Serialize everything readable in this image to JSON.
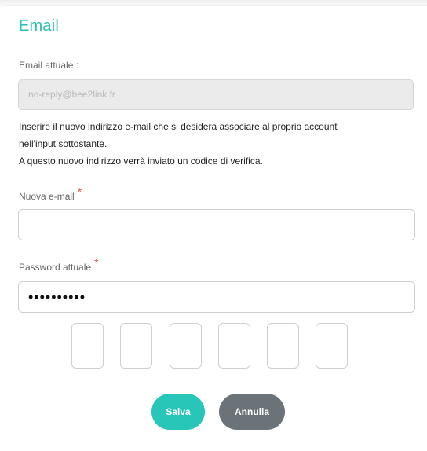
{
  "title": "Email",
  "current_email": {
    "label": "Email attuale :",
    "value": "no-reply@bee2link.fr"
  },
  "info": {
    "line1": "Inserire il nuovo indirizzo e-mail che si desidera associare al proprio account",
    "line2": "nell'input sottostante.",
    "line3": "A questo nuovo indirizzo verrà inviato un codice di verifica."
  },
  "new_email": {
    "label": "Nuova e-mail",
    "required_mark": "*",
    "value": ""
  },
  "current_password": {
    "label": "Password attuale",
    "required_mark": "*",
    "value": "••••••••••"
  },
  "verification_code": {
    "digits": [
      "",
      "",
      "",
      "",
      "",
      ""
    ]
  },
  "buttons": {
    "save": "Salva",
    "cancel": "Annulla"
  },
  "colors": {
    "accent": "#2bbdb4",
    "save_button": "#27c6b9",
    "cancel_button": "#6b7378",
    "required": "#d9534f"
  }
}
